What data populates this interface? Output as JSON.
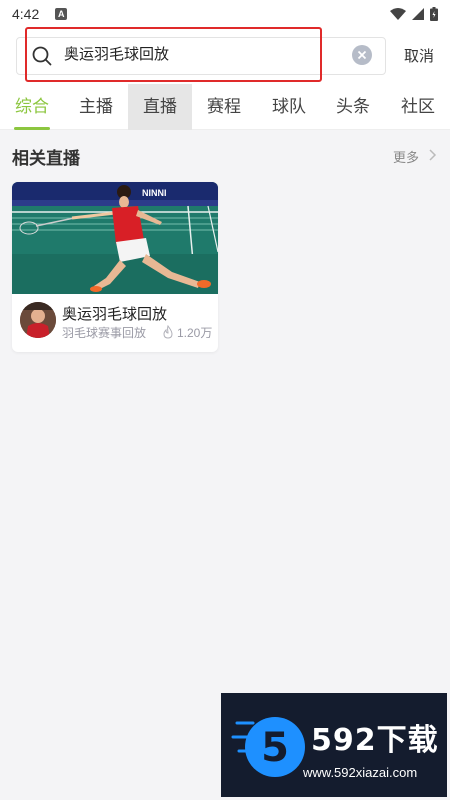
{
  "status_bar": {
    "time": "4:42",
    "notification_badge": "A",
    "icons": [
      "wifi-icon",
      "signal-icon",
      "battery-icon"
    ]
  },
  "search": {
    "query": "奥运羽毛球回放",
    "cancel_label": "取消"
  },
  "tabs": [
    {
      "label": "综合",
      "active": true
    },
    {
      "label": "主播"
    },
    {
      "label": "直播",
      "pressed": true
    },
    {
      "label": "赛程"
    },
    {
      "label": "球队"
    },
    {
      "label": "头条"
    },
    {
      "label": "社区"
    }
  ],
  "section": {
    "title": "相关直播",
    "more_label": "更多"
  },
  "live_cards": [
    {
      "title": "奥运羽毛球回放",
      "subtitle": "羽毛球赛事回放",
      "viewers": "1.20万"
    }
  ],
  "watermark": {
    "brand": "592下载",
    "url": "www.592xiazai.com",
    "logo_digit": "5"
  },
  "colors": {
    "accent": "#8cc63f",
    "highlight_box": "#e02a2a",
    "watermark_bg": "#141c2e",
    "logo_blue": "#1e90ff"
  }
}
